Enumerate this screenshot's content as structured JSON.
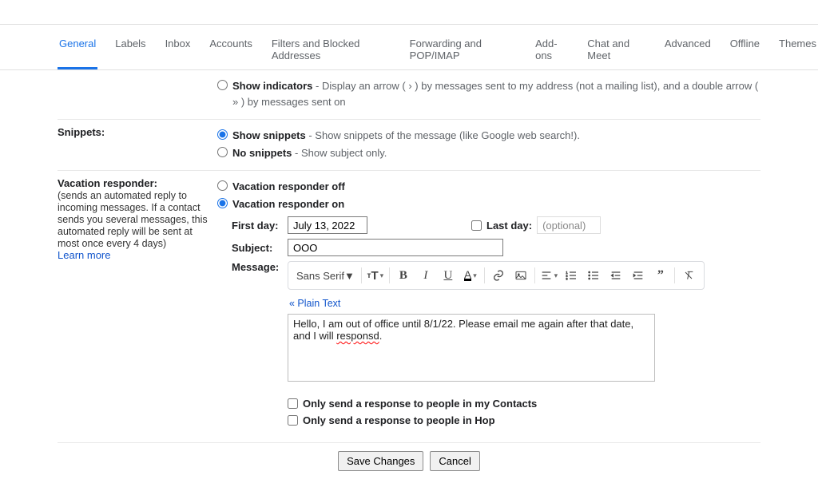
{
  "tabs": [
    "General",
    "Labels",
    "Inbox",
    "Accounts",
    "Filters and Blocked Addresses",
    "Forwarding and POP/IMAP",
    "Add-ons",
    "Chat and Meet",
    "Advanced",
    "Offline",
    "Themes"
  ],
  "active_tab": 0,
  "indicators": {
    "show_label": "Show indicators",
    "show_desc": " - Display an arrow ( › ) by messages sent to my address (not a mailing list), and a double arrow ( » ) by messages sent on"
  },
  "snippets": {
    "title": "Snippets:",
    "show_label": "Show snippets",
    "show_desc": " - Show snippets of the message (like Google web search!).",
    "no_label": "No snippets",
    "no_desc": " - Show subject only."
  },
  "vacation": {
    "title": "Vacation responder:",
    "desc": "(sends an automated reply to incoming messages. If a contact sends you several messages, this automated reply will be sent at most once every 4 days)",
    "learn_more": "Learn more",
    "off_label": "Vacation responder off",
    "on_label": "Vacation responder on",
    "first_day_label": "First day:",
    "first_day_value": "July 13, 2022",
    "last_day_label": "Last day:",
    "last_day_placeholder": "(optional)",
    "subject_label": "Subject:",
    "subject_value": "OOO",
    "message_label": "Message:",
    "font_name": "Sans Serif",
    "plain_text": "« Plain Text",
    "body_prefix": "Hello, I am out of office until 8/1/22. Please email me again after that date, and I will ",
    "body_typo": "responsd",
    "body_suffix": ".",
    "only_contacts": "Only send a response to people in my Contacts",
    "only_org": "Only send a response to people in Hop"
  },
  "buttons": {
    "save": "Save Changes",
    "cancel": "Cancel"
  }
}
